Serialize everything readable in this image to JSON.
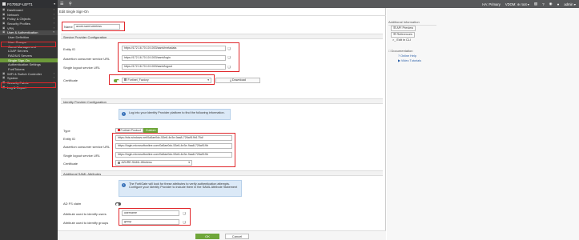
{
  "topbar": {
    "device_name": "FG7051F-LEFT1",
    "ha_status": "HA: Primary",
    "vdom": "VDOM: ⊕ root ▾",
    "admin": "admin ▾"
  },
  "sidebar": {
    "items": [
      {
        "label": "Dashboard",
        "type": "group"
      },
      {
        "label": "Network",
        "type": "group"
      },
      {
        "label": "Policy & Objects",
        "type": "group"
      },
      {
        "label": "Security Profiles",
        "type": "group"
      },
      {
        "label": "VPN",
        "type": "group"
      },
      {
        "label": "User & Authentication",
        "type": "group-open"
      },
      {
        "label": "User Definition",
        "type": "sub"
      },
      {
        "label": "User Groups",
        "type": "sub"
      },
      {
        "label": "Guest Management",
        "type": "sub"
      },
      {
        "label": "LDAP Servers",
        "type": "sub"
      },
      {
        "label": "RADIUS Servers",
        "type": "sub"
      },
      {
        "label": "Single Sign-On",
        "type": "sub-active"
      },
      {
        "label": "Authentication Settings",
        "type": "sub"
      },
      {
        "label": "FortiTokens",
        "type": "sub"
      },
      {
        "label": "WiFi & Switch Controller",
        "type": "group"
      },
      {
        "label": "System",
        "type": "group"
      },
      {
        "label": "Security Fabric",
        "type": "group"
      },
      {
        "label": "Log & Report",
        "type": "group"
      }
    ]
  },
  "main": {
    "title": "Edit Single Sign-On",
    "name_label": "Name",
    "name_value": "azure-saml-wireless",
    "sp_section": "Service Provider Configuration",
    "entity_id_label": "Entity ID",
    "entity_id_value": "https://172.16.70.10:1003/saml/metadata",
    "acs_url_label": "Assertion consumer service URL",
    "acs_url_value": "https://172.16.70.10:1003/saml/login",
    "slo_url_label": "Single logout service URL",
    "slo_url_value": "https://172.16.70.10:1003/saml/logout",
    "certificate_label": "Certificate",
    "certificate_value": "Fortinet_Factory",
    "download_label": "Download",
    "idp_section": "Identity Provider Configuration",
    "idp_info": "Log into your Identity Provider platform to find the following information.",
    "type_label": "Type",
    "type_fortinet": "Fortinet Product",
    "type_custom": "Custom",
    "idp_entity_id_label": "Entity ID",
    "idp_entity_id_value": "https://sts.windows.net/0a5ae0dc-53e6-4e3e-9aa8-726a919b175d/",
    "idp_sso_url_label": "Assertion consumer service URL",
    "idp_sso_url_value": "https://login.microsoftonline.com/0a5ae0dc-53e6-4e3e-9aa8-726a919b",
    "idp_slo_url_label": "Single logout service URL",
    "idp_slo_url_value": "https://login.microsoftonline.com/0a5ae0dc-53e6-4e3e-9aa8-726a919b",
    "idp_cert_label": "Certificate",
    "idp_cert_value": "AZURE-SAML-Wireless",
    "saml_section": "Additional SAML Attributes",
    "saml_info": "The FortiGate will look for these attributes to verify authentication attempts. Configure your Identity Provider to include them in the SAML Attribute Statement",
    "ad_fs_label": "AD FS claim",
    "attr_user_label": "Attribute used to identify users",
    "attr_user_value": "username",
    "attr_group_label": "Attribute used to identify groups",
    "attr_group_value": "group",
    "ok_label": "OK",
    "cancel_label": "Cancel"
  },
  "rpanel": {
    "heading": "Additional Information",
    "api_preview": "API Preview",
    "references": "References",
    "edit_cli": "Edit in CLI",
    "doc_heading": "Documentation",
    "online_help": "Online Help",
    "video_tutorials": "Video Tutorials"
  },
  "colors": {
    "accent_green": "#6fa63a",
    "highlight_red": "#e0262a",
    "sidebar_bg": "#353535"
  }
}
